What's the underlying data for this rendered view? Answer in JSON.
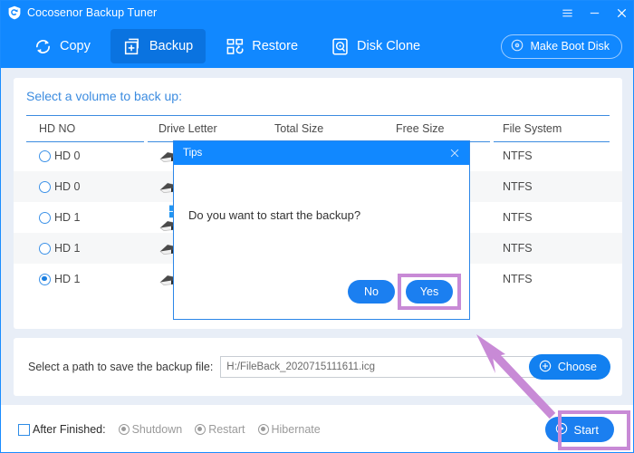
{
  "window": {
    "title": "Cocosenor Backup Tuner",
    "logo_icon": "shield-refresh-icon",
    "controls": [
      {
        "name": "menu",
        "icon": "hamburger-icon"
      },
      {
        "name": "minimize",
        "icon": "minimize-icon"
      },
      {
        "name": "close",
        "icon": "close-icon"
      }
    ]
  },
  "toolbar": {
    "items": [
      {
        "label": "Copy",
        "icon": "copy-refresh-icon",
        "active": false
      },
      {
        "label": "Backup",
        "icon": "backup-plus-icon",
        "active": true
      },
      {
        "label": "Restore",
        "icon": "restore-blocks-icon",
        "active": false
      },
      {
        "label": "Disk Clone",
        "icon": "disk-clone-icon",
        "active": false
      }
    ],
    "boot_disk_label": "Make Boot Disk",
    "boot_disk_icon": "disc-icon"
  },
  "panel": {
    "title": "Select a volume to back up:",
    "columns": [
      "HD NO",
      "Drive Letter",
      "Total Size",
      "Free Size",
      "File System"
    ],
    "rows": [
      {
        "hd_no": "HD 0",
        "selected": false,
        "drive_icon": "hard-disk-icon",
        "windows_icon": false,
        "file_system": "NTFS"
      },
      {
        "hd_no": "HD 0",
        "selected": false,
        "drive_icon": "hard-disk-icon",
        "windows_icon": false,
        "file_system": "NTFS"
      },
      {
        "hd_no": "HD 1",
        "selected": false,
        "drive_icon": "hard-disk-icon",
        "windows_icon": true,
        "file_system": "NTFS"
      },
      {
        "hd_no": "HD 1",
        "selected": false,
        "drive_icon": "hard-disk-icon",
        "windows_icon": false,
        "file_system": "NTFS"
      },
      {
        "hd_no": "HD 1",
        "selected": true,
        "drive_icon": "hard-disk-icon",
        "windows_icon": false,
        "file_system": "NTFS"
      }
    ]
  },
  "path_bar": {
    "label": "Select a path to save the backup file:",
    "value": "H:/FileBack_2020715111611.icg",
    "placeholder": "",
    "choose_label": "Choose",
    "choose_icon": "plus-circle-icon"
  },
  "bottom_bar": {
    "after_finished_label": "After Finished:",
    "checked": false,
    "options": [
      {
        "label": "Shutdown",
        "selected": true,
        "disabled": true
      },
      {
        "label": "Restart",
        "selected": true,
        "disabled": true
      },
      {
        "label": "Hibernate",
        "selected": true,
        "disabled": true
      }
    ],
    "start_label": "Start",
    "start_icon": "play-circle-icon"
  },
  "dialog": {
    "title": "Tips",
    "close_icon": "close-icon",
    "message": "Do you want to start the backup?",
    "no_label": "No",
    "yes_label": "Yes"
  },
  "annotations": {
    "highlight_color": "#c88ad6",
    "arrow_color": "#c88ad6",
    "highlights": [
      "yes-button",
      "start-button"
    ],
    "arrow": "points-to-dialog"
  },
  "colors": {
    "brand_blue": "#1188ff",
    "active_tab": "#0a73e0",
    "button_blue": "#1b7ff0",
    "accent_link": "#3c8ce0",
    "app_background": "#e8eef7",
    "panel_background": "#ffffff",
    "row_alt": "#f6f7f8"
  }
}
